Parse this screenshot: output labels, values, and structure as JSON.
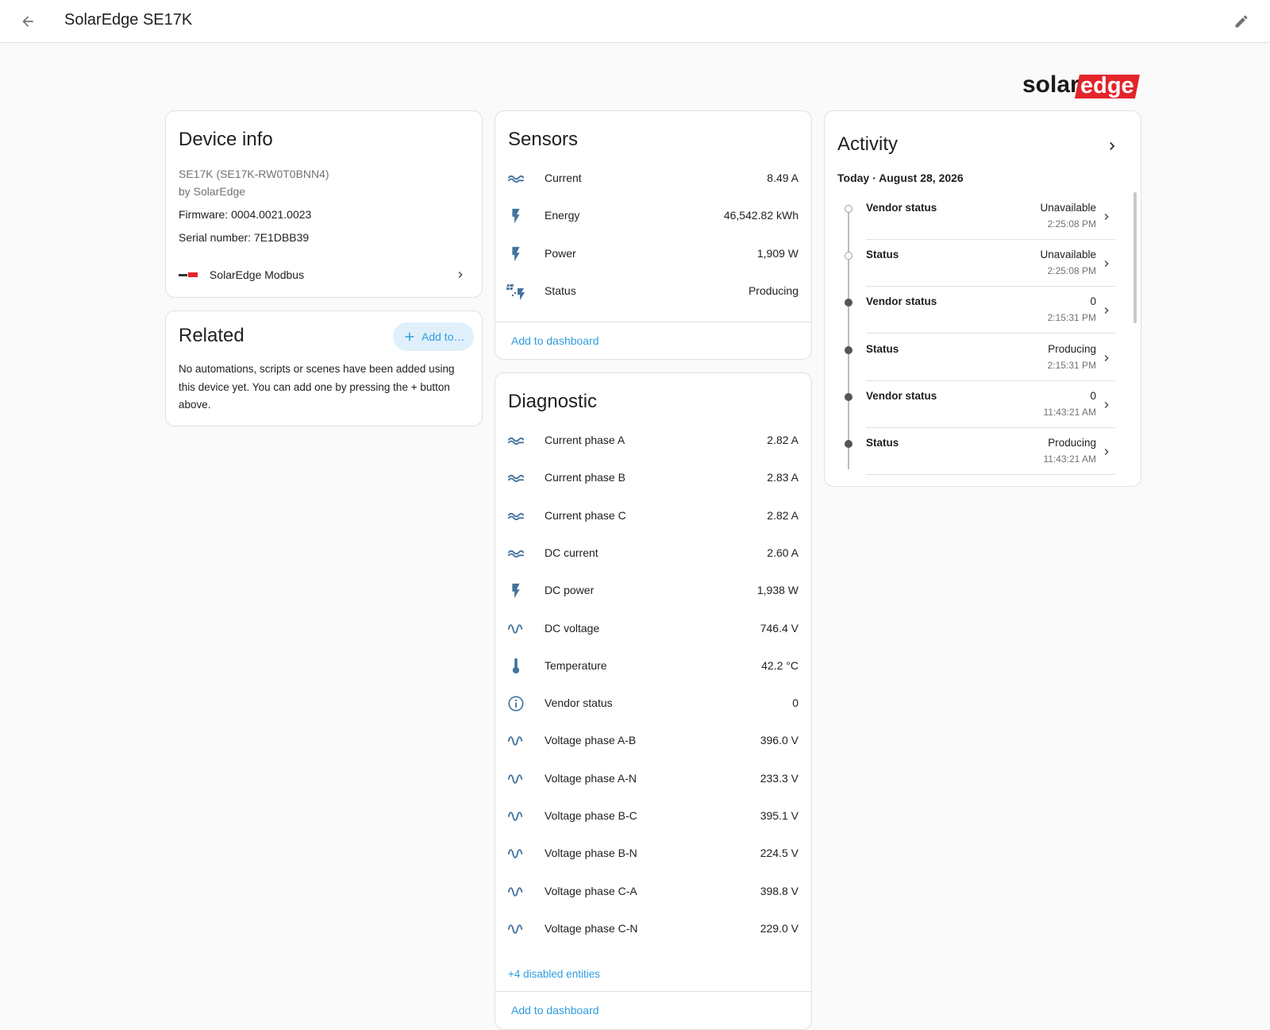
{
  "header": {
    "title": "SolarEdge SE17K"
  },
  "brand": {
    "logo_dark": "solar",
    "logo_red": "edge",
    "dark_color": "#1a1a1a",
    "red_color": "#e3242b"
  },
  "device_info": {
    "title": "Device info",
    "model": "SE17K (SE17K-RW0T0BNN4)",
    "manufacturer": "by SolarEdge",
    "firmware": "Firmware: 0004.0021.0023",
    "serial": "Serial number: 7E1DBB39",
    "integration": "SolarEdge Modbus"
  },
  "related": {
    "title": "Related",
    "add_button": "Add to…",
    "empty_text": "No automations, scripts or scenes have been added using this device yet. You can add one by pressing the + button above."
  },
  "sensors": {
    "title": "Sensors",
    "items": [
      {
        "icon": "current-ac-icon",
        "label": "Current",
        "value": "8.49 A"
      },
      {
        "icon": "flash-icon",
        "label": "Energy",
        "value": "46,542.82 kWh"
      },
      {
        "icon": "flash-icon",
        "label": "Power",
        "value": "1,909 W"
      },
      {
        "icon": "solar-power-icon",
        "label": "Status",
        "value": "Producing"
      }
    ],
    "add_to_dashboard": "Add to dashboard"
  },
  "diagnostic": {
    "title": "Diagnostic",
    "items": [
      {
        "icon": "current-ac-icon",
        "label": "Current phase A",
        "value": "2.82 A"
      },
      {
        "icon": "current-ac-icon",
        "label": "Current phase B",
        "value": "2.83 A"
      },
      {
        "icon": "current-ac-icon",
        "label": "Current phase C",
        "value": "2.82 A"
      },
      {
        "icon": "current-ac-icon",
        "label": "DC current",
        "value": "2.60 A"
      },
      {
        "icon": "flash-icon",
        "label": "DC power",
        "value": "1,938 W"
      },
      {
        "icon": "sine-wave-icon",
        "label": "DC voltage",
        "value": "746.4 V"
      },
      {
        "icon": "thermometer-icon",
        "label": "Temperature",
        "value": "42.2 °C"
      },
      {
        "icon": "information-icon",
        "label": "Vendor status",
        "value": "0"
      },
      {
        "icon": "sine-wave-icon",
        "label": "Voltage phase A-B",
        "value": "396.0 V"
      },
      {
        "icon": "sine-wave-icon",
        "label": "Voltage phase A-N",
        "value": "233.3 V"
      },
      {
        "icon": "sine-wave-icon",
        "label": "Voltage phase B-C",
        "value": "395.1 V"
      },
      {
        "icon": "sine-wave-icon",
        "label": "Voltage phase B-N",
        "value": "224.5 V"
      },
      {
        "icon": "sine-wave-icon",
        "label": "Voltage phase C-A",
        "value": "398.8 V"
      },
      {
        "icon": "sine-wave-icon",
        "label": "Voltage phase C-N",
        "value": "229.0 V"
      }
    ],
    "disabled_entities": "+4 disabled entities",
    "add_to_dashboard": "Add to dashboard"
  },
  "activity": {
    "title": "Activity",
    "date": "Today · August 28, 2026",
    "entries": [
      {
        "name": "Vendor status",
        "state": "Unavailable",
        "time": "2:25:08 PM",
        "dot": "hollow"
      },
      {
        "name": "Status",
        "state": "Unavailable",
        "time": "2:25:08 PM",
        "dot": "hollow"
      },
      {
        "name": "Vendor status",
        "state": "0",
        "time": "2:15:31 PM",
        "dot": "filled"
      },
      {
        "name": "Status",
        "state": "Producing",
        "time": "2:15:31 PM",
        "dot": "filled"
      },
      {
        "name": "Vendor status",
        "state": "0",
        "time": "11:43:21 AM",
        "dot": "filled"
      },
      {
        "name": "Status",
        "state": "Producing",
        "time": "11:43:21 AM",
        "dot": "filled"
      }
    ]
  },
  "colors": {
    "accent": "#2e9de0",
    "icon": "#44739e",
    "divider": "#e0e0e0"
  }
}
